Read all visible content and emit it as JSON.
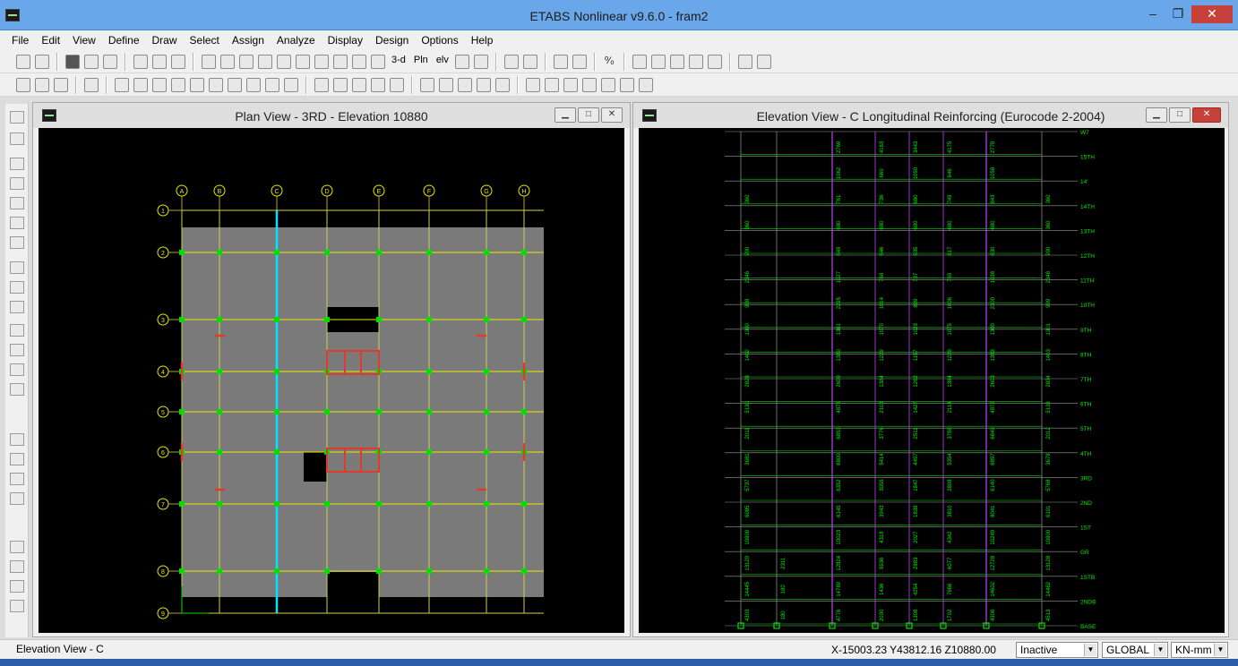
{
  "app": {
    "title": "ETABS Nonlinear v9.6.0 - fram2",
    "min_label": "–",
    "max_label": "❐",
    "close_label": "✕"
  },
  "menu": [
    "File",
    "Edit",
    "View",
    "Define",
    "Draw",
    "Select",
    "Assign",
    "Analyze",
    "Display",
    "Design",
    "Options",
    "Help"
  ],
  "toolbar": {
    "three_d_label": "3-d",
    "pln_label": "Pln",
    "elv_label": "elv",
    "percent_label": "⁰⁄₀"
  },
  "plan_view": {
    "title": "Plan View - 3RD - Elevation 10880",
    "grid_x_labels": [
      "A",
      "B",
      "C",
      "D",
      "E",
      "F",
      "G",
      "H"
    ],
    "grid_y_labels": [
      "1",
      "2",
      "3",
      "4",
      "5",
      "6",
      "7",
      "8",
      "9"
    ],
    "colors": {
      "slab": "#7a7a7a",
      "beam": "#e8e800",
      "column": "#00dd00",
      "highlight": "#00e5ff",
      "wall": "#e23a2a"
    }
  },
  "elevation_view": {
    "title": "Elevation View - C  Longitudinal Reinforcing  (Eurocode 2-2004)",
    "story_labels": [
      "W7",
      "15TH",
      "14'",
      "14TH",
      "13TH",
      "12TH",
      "11TH",
      "10TH",
      "9TH",
      "8TH",
      "7TH",
      "6TH",
      "5TH",
      "4TH",
      "3RD",
      "2ND",
      "1ST",
      "GR",
      "1STB",
      "2NDB",
      "BASE"
    ],
    "reinforcing_rows": [
      [
        "",
        "",
        "2769",
        "4163",
        "3443",
        "4175",
        "2778",
        ""
      ],
      [
        "",
        "",
        "1062",
        "660",
        "1050",
        "646",
        "1058",
        ""
      ],
      [
        "360",
        "",
        "761",
        "736",
        "680",
        "749",
        "843",
        "360"
      ],
      [
        "360",
        "",
        "680",
        "680",
        "680",
        "680",
        "680",
        "360"
      ],
      [
        "990",
        "",
        "649",
        "646",
        "635",
        "617",
        "630",
        "990"
      ],
      [
        "2346",
        "",
        "1027",
        "768",
        "737",
        "769",
        "1038",
        "2348"
      ],
      [
        "998",
        "",
        "2295",
        "1014",
        "889",
        "1006",
        "2300",
        "999"
      ],
      [
        "1300",
        "",
        "1361",
        "1070",
        "1023",
        "1075",
        "1300",
        "1301"
      ],
      [
        "1402",
        "",
        "1380",
        "1229",
        "1157",
        "1229",
        "1383",
        "1403"
      ],
      [
        "2828",
        "",
        "2600",
        "1384",
        "1282",
        "1384",
        "2603",
        "2834"
      ],
      [
        "5130",
        "",
        "4875",
        "2103",
        "1427",
        "2114",
        "4872",
        "5138"
      ],
      [
        "2011",
        "",
        "6853",
        "3776",
        "2511",
        "3788",
        "6849",
        "2012"
      ],
      [
        "3681",
        "",
        "6800",
        "5414",
        "4497",
        "5354",
        "6897",
        "3678"
      ],
      [
        "5737",
        "",
        "6352",
        "3055",
        "1847",
        "2808",
        "6140",
        "5768"
      ],
      [
        "6085",
        "",
        "6145",
        "3943",
        "1838",
        "3810",
        "8041",
        "6101"
      ],
      [
        "10809",
        "",
        "10023",
        "4318",
        "2027",
        "4342",
        "10249",
        "10800"
      ],
      [
        "13129",
        "2311",
        "12824",
        "5936",
        "2883",
        "6077",
        "12728",
        "13128"
      ],
      [
        "14445",
        "180",
        "14789",
        "1436",
        "4254",
        "7666",
        "14602",
        "14462"
      ],
      [
        "4303",
        "180",
        "4776",
        "2030",
        "1308",
        "1702",
        "4306",
        "4513"
      ]
    ],
    "colors": {
      "frame": "#00dd00",
      "column": "#c040ff",
      "text": "#00ee00"
    }
  },
  "status": {
    "left_text": "Elevation View - C",
    "coords": "X-15003.23  Y43812.16  Z10880.00",
    "story_mode": "Inactive",
    "coord_system": "GLOBAL",
    "units": "KN-mm"
  }
}
